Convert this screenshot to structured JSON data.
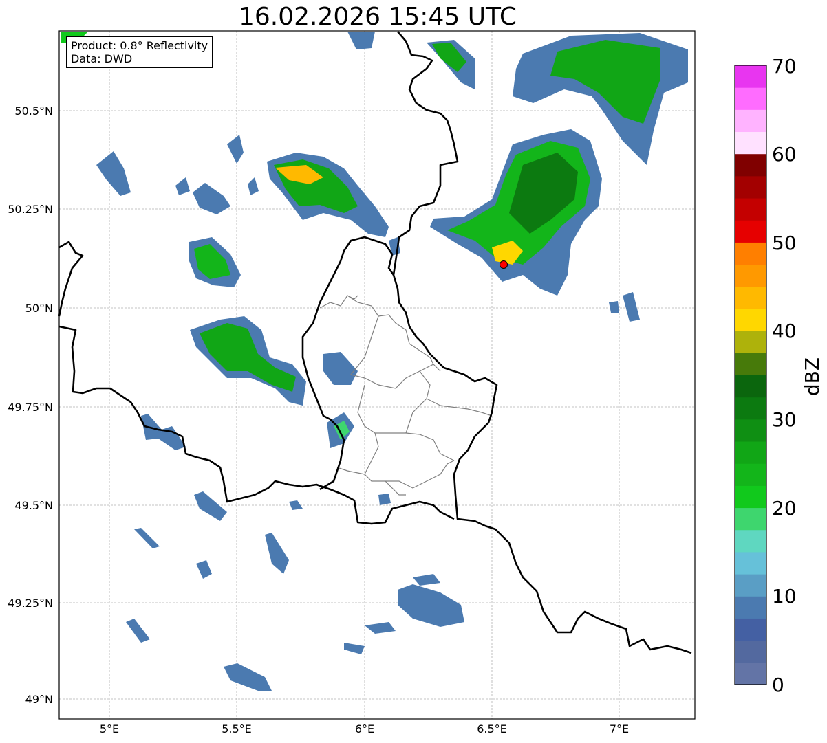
{
  "title": "16.02.2026 15:45 UTC",
  "info": {
    "product": "Product: 0.8° Reflectivity",
    "source": "Data: DWD"
  },
  "lat_ticks": [
    "50.5°N",
    "50.25°N",
    "50°N",
    "49.75°N",
    "49.5°N",
    "49.25°N",
    "49°N"
  ],
  "lon_ticks": [
    "5°E",
    "5.5°E",
    "6°E",
    "6.5°E",
    "7°E"
  ],
  "colorbar": {
    "label": "dBZ",
    "ticks": [
      "0",
      "10",
      "20",
      "30",
      "40",
      "50",
      "60",
      "70"
    ],
    "colors": [
      "#6374a6",
      "#53699f",
      "#4460a3",
      "#4b7ab0",
      "#5a9ec5",
      "#66c1d9",
      "#5fd7c0",
      "#3ed66e",
      "#11c91c",
      "#13b51a",
      "#11a616",
      "#0f8f13",
      "#0c7a10",
      "#0b660d",
      "#477a0a",
      "#aeb20b",
      "#ffd700",
      "#ffb900",
      "#ff9900",
      "#ff7f00",
      "#e60000",
      "#c40000",
      "#a30000",
      "#800000",
      "#ffe1ff",
      "#ffb3ff",
      "#ff6cff",
      "#e835f0"
    ]
  },
  "radar_site": {
    "color": "#ff0000"
  },
  "colors": {
    "border": "#000000",
    "admin": "#808080",
    "grid": "#b0b0b0"
  }
}
